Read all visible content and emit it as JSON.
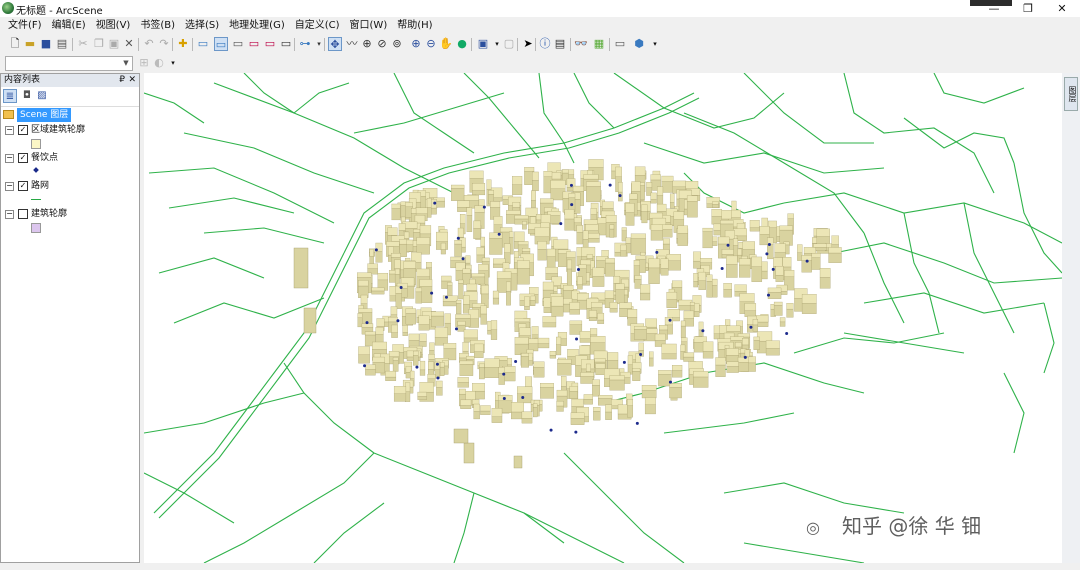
{
  "window": {
    "title": "无标题 - ArcScene",
    "minimize": "—",
    "restore": "❐",
    "close": "✕"
  },
  "menu": [
    "文件(F)",
    "编辑(E)",
    "视图(V)",
    "书签(B)",
    "选择(S)",
    "地理处理(G)",
    "自定义(C)",
    "窗口(W)",
    "帮助(H)"
  ],
  "toc": {
    "title": "内容列表",
    "pin": "₽",
    "close": "✕",
    "scene_label": "Scene 图层",
    "layers": [
      {
        "name": "区域建筑轮廓",
        "checked": true,
        "symbol": "fill",
        "color": "#fbf6c6"
      },
      {
        "name": "餐饮点",
        "checked": true,
        "symbol": "point",
        "color": "#1a2a8a"
      },
      {
        "name": "路网",
        "checked": true,
        "symbol": "line",
        "color": "#27a844"
      },
      {
        "name": "建筑轮廓",
        "checked": false,
        "symbol": "fill",
        "color": "#dcc6ee"
      }
    ]
  },
  "right_dock": {
    "tab_label": "图层"
  },
  "scene": {
    "road_color": "#2fb24a",
    "building_color": "#d9d3a0",
    "building_edge": "#a49c6a",
    "poi_color": "#1c2a8c"
  },
  "watermark": {
    "text": "知乎 @徐 华 钿"
  }
}
